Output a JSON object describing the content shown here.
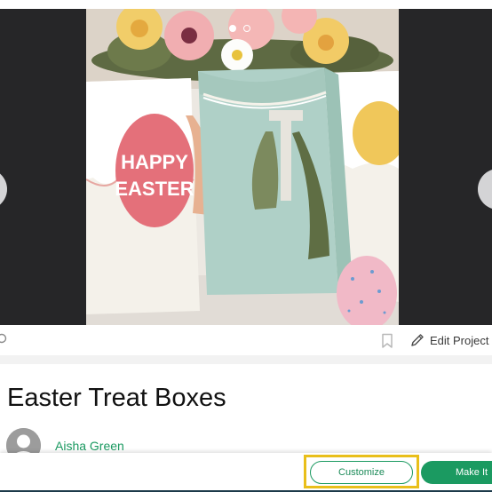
{
  "carousel": {
    "slide_count": 2,
    "active_slide": 1,
    "tag_text": [
      "HAPPY",
      "EASTER"
    ]
  },
  "actions": {
    "edit_label": "Edit Project",
    "bookmark_icon": "bookmark-icon",
    "edit_icon": "pencil-icon"
  },
  "project": {
    "title": "Easter Treat Boxes",
    "author": "Aisha Green"
  },
  "buttons": {
    "customize": "Customize",
    "make_it": "Make It"
  },
  "colors": {
    "accent_green": "#1b9a61",
    "highlight_yellow": "#e9bf1a",
    "carousel_bg": "#262628"
  }
}
